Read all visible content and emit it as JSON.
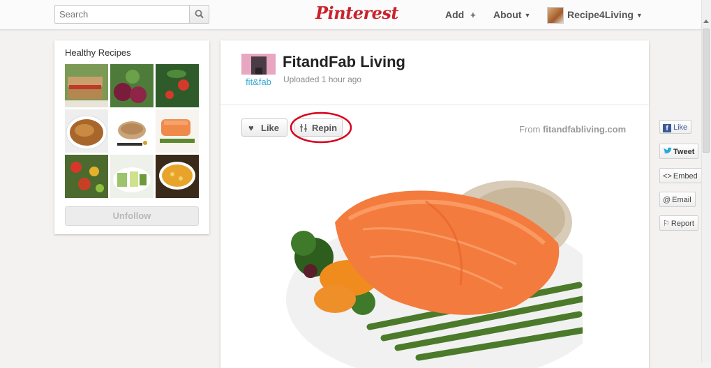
{
  "header": {
    "search_placeholder": "Search",
    "logo": "Pinterest",
    "add_label": "Add",
    "add_icon": "+",
    "about_label": "About",
    "user_label": "Recipe4Living"
  },
  "sidebar": {
    "board_title": "Healthy Recipes",
    "unfollow_label": "Unfollow"
  },
  "pin": {
    "user_name": "FitandFab Living",
    "uploaded": "Uploaded 1 hour ago",
    "avatar_text": "fit&fab",
    "like_label": "Like",
    "repin_label": "Repin",
    "source_prefix": "From",
    "source_domain": "fitandfabliving.com"
  },
  "social": {
    "fb_like": "Like",
    "tweet": "Tweet",
    "embed": "Embed",
    "email": "Email",
    "report": "Report"
  },
  "colors": {
    "brand_red": "#c8232c",
    "annotation_circle": "#d9001b"
  }
}
